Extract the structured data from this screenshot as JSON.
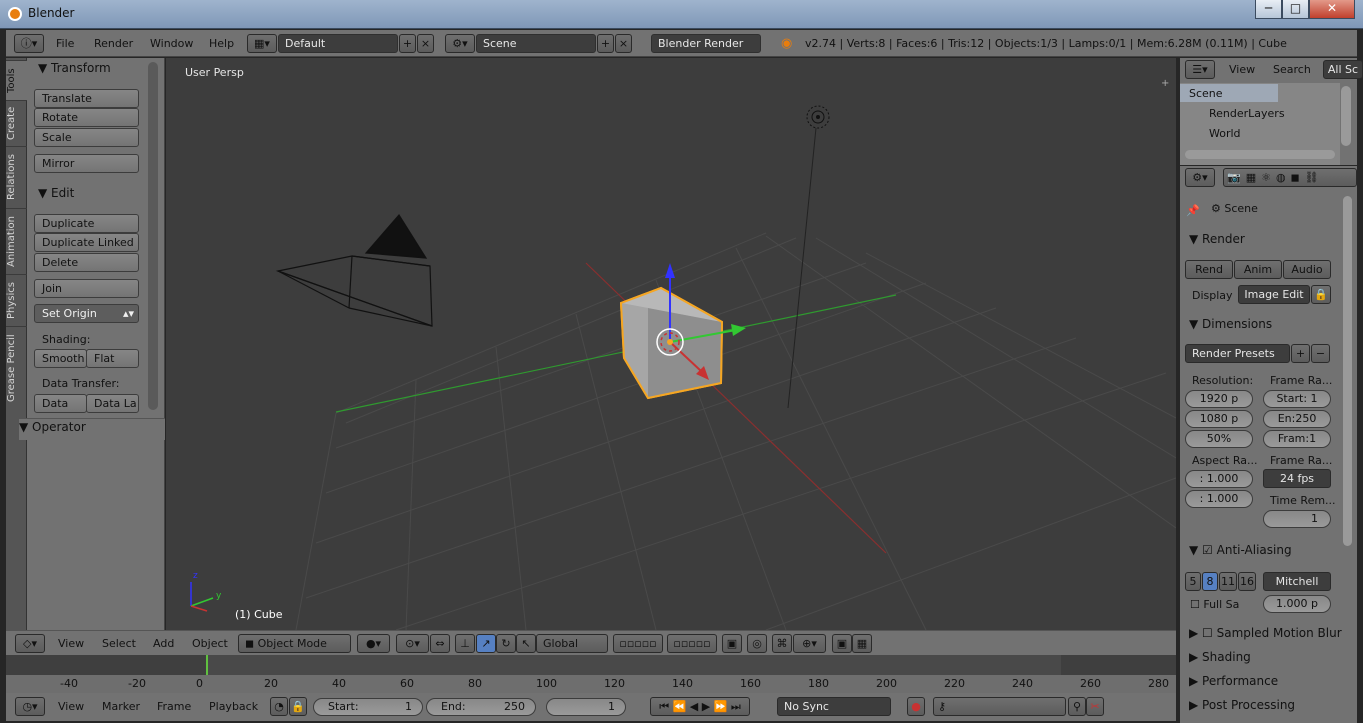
{
  "window": {
    "title": "Blender",
    "min_label": "─",
    "max_label": "□",
    "close_label": "✕"
  },
  "topbar": {
    "menus": [
      "File",
      "Render",
      "Window",
      "Help"
    ],
    "screen_layout": "Default",
    "scene": "Scene",
    "render_engine": "Blender Render",
    "stats": "v2.74 | Verts:8 | Faces:6 | Tris:12 | Objects:1/3 | Lamps:0/1 | Mem:6.28M (0.11M) | Cube"
  },
  "tool_tabs": [
    "Tools",
    "Create",
    "Relations",
    "Animation",
    "Physics",
    "Grease Pencil"
  ],
  "tool_panel": {
    "transform_header": "Transform",
    "translate": "Translate",
    "rotate": "Rotate",
    "scale": "Scale",
    "mirror": "Mirror",
    "edit_header": "Edit",
    "duplicate": "Duplicate",
    "duplicate_linked": "Duplicate Linked",
    "delete": "Delete",
    "join": "Join",
    "set_origin": "Set Origin",
    "shading_label": "Shading:",
    "smooth": "Smooth",
    "flat": "Flat",
    "data_transfer_label": "Data Transfer:",
    "data": "Data",
    "data_layout": "Data La",
    "operator_header": "Operator"
  },
  "viewport": {
    "view_label": "User Persp",
    "object_label": "(1) Cube"
  },
  "viewport_header": {
    "menus": [
      "View",
      "Select",
      "Add",
      "Object"
    ],
    "mode": "Object Mode",
    "orientation": "Global"
  },
  "timeline": {
    "ticks": [
      "-40",
      "-20",
      "0",
      "20",
      "40",
      "60",
      "80",
      "100",
      "120",
      "140",
      "160",
      "180",
      "200",
      "220",
      "240",
      "260",
      "280"
    ],
    "current_frame": 0
  },
  "timeline_header": {
    "menus": [
      "View",
      "Marker",
      "Frame",
      "Playback"
    ],
    "start_label": "Start:",
    "start_value": "1",
    "end_label": "End:",
    "end_value": "250",
    "current": "1",
    "sync": "No Sync"
  },
  "outliner": {
    "view": "View",
    "search": "Search",
    "all_scenes": "All Sc",
    "items": [
      "Scene",
      "RenderLayers",
      "World"
    ]
  },
  "properties": {
    "scene": "Scene",
    "render_header": "Render",
    "render_btn": "Rend",
    "anim_btn": "Anim",
    "audio_btn": "Audio",
    "display_label": "Display",
    "display_value": "Image Edit",
    "dimensions_header": "Dimensions",
    "render_presets": "Render Presets",
    "resolution_label": "Resolution:",
    "frame_range_label": "Frame Ra...",
    "res_x": "1920 p",
    "res_y": "1080 p",
    "res_pct": "50%",
    "start": "Start: 1",
    "end": "En:250",
    "frame": "Fram:1",
    "aspect_label": "Aspect Ra...",
    "frame_rate_label": "Frame Ra...",
    "aspect_x": ": 1.000",
    "aspect_y": ": 1.000",
    "fps": "24 fps",
    "time_remap_label": "Time Rem...",
    "time_remap_value": "1",
    "aa_header": "Anti-Aliasing",
    "aa_samples": [
      "5",
      "8",
      "11",
      "16"
    ],
    "aa_filter": "Mitchell",
    "full_sample": "Full Sa",
    "filter_size": "1.000 p",
    "sampled_motion_blur": "Sampled Motion Blur",
    "shading": "Shading",
    "performance": "Performance",
    "post_processing": "Post Processing"
  },
  "colors": {
    "accent_orange": "#f5a623",
    "active_blue": "#5680c2",
    "x_axis": "#c83232",
    "y_axis": "#32c832",
    "z_axis": "#3232ff"
  }
}
